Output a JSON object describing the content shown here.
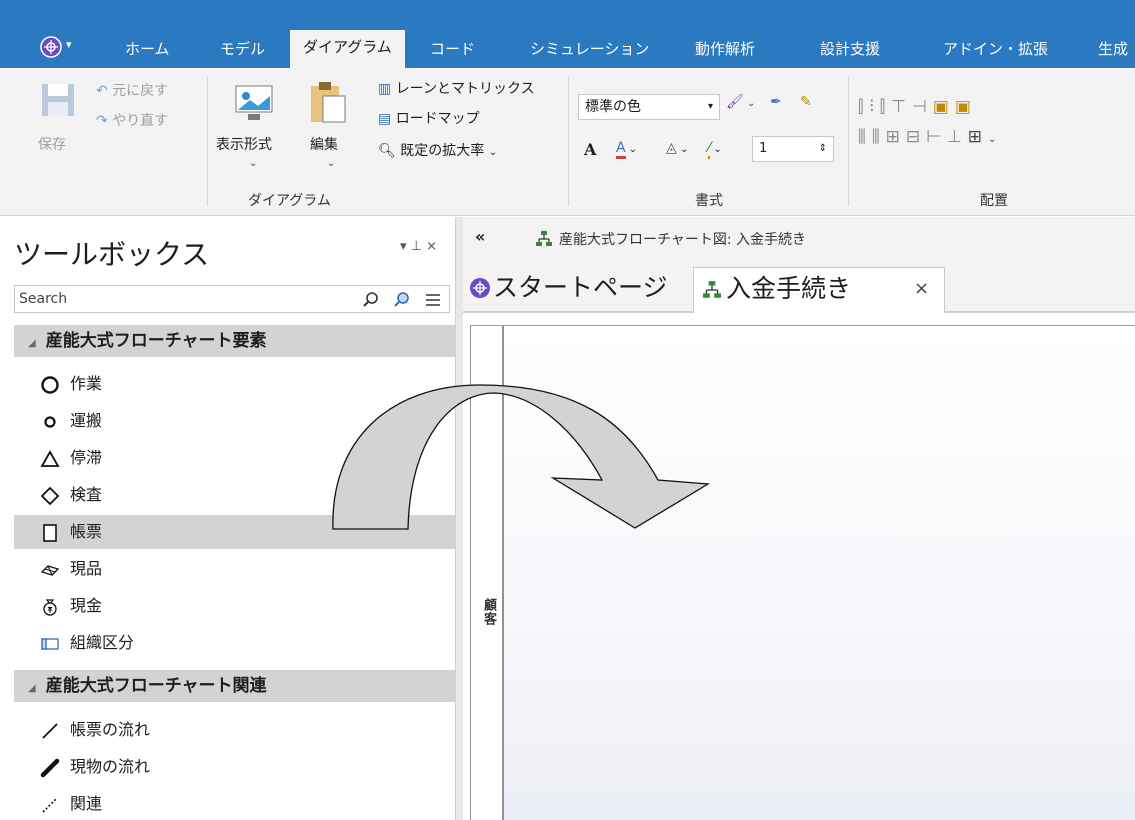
{
  "ribbon": {
    "tabs": [
      "ホーム",
      "モデル",
      "ダイアグラム",
      "コード",
      "シミュレーション",
      "動作解析",
      "設計支援",
      "アドイン・拡張",
      "生成"
    ],
    "active_tab": "ダイアグラム",
    "save_label": "保存",
    "undo_label": "元に戻す",
    "redo_label": "やり直す",
    "display_format_label": "表示形式",
    "edit_label": "編集",
    "lanes_matrix_label": "レーンとマトリックス",
    "roadmap_label": "ロードマップ",
    "default_zoom_label": "既定の拡大率",
    "diagram_group_label": "ダイアグラム",
    "color_combo_value": "標準の色",
    "line_width_value": "1",
    "format_group_label": "書式",
    "layout_group_label": "配置"
  },
  "toolbox": {
    "title": "ツールボックス",
    "pin_glyph": "▾ ⊥ ×",
    "search_placeholder": "Search",
    "sections": [
      {
        "label": "産能大式フローチャート要素",
        "items": [
          {
            "label": "作業",
            "icon": "large-circle-icon"
          },
          {
            "label": "運搬",
            "icon": "small-circle-icon"
          },
          {
            "label": "停滞",
            "icon": "triangle-icon"
          },
          {
            "label": "検査",
            "icon": "diamond-icon"
          },
          {
            "label": "帳票",
            "icon": "rectangle-icon",
            "selected": true
          },
          {
            "label": "現品",
            "icon": "goods-icon"
          },
          {
            "label": "現金",
            "icon": "money-bag-icon"
          },
          {
            "label": "組織区分",
            "icon": "org-partition-icon"
          }
        ]
      },
      {
        "label": "産能大式フローチャート関連",
        "items": [
          {
            "label": "帳票の流れ",
            "icon": "line-icon"
          },
          {
            "label": "現物の流れ",
            "icon": "bold-line-icon"
          },
          {
            "label": "関連",
            "icon": "dotted-line-icon"
          }
        ]
      }
    ]
  },
  "editor": {
    "collapse_glyph": "«",
    "breadcrumb": "産能大式フローチャート図: 入金手続き",
    "tabs": [
      {
        "label": "スタートページ"
      },
      {
        "label": "入金手続き",
        "close": "×"
      }
    ],
    "lane_label": "顧客"
  },
  "colors": {
    "ribbon_blue": "#2b79c0",
    "ribbon_bg": "#f3f3f3",
    "selection_gray": "#d3d3d3",
    "arrow_fill": "#d3d3d3"
  }
}
